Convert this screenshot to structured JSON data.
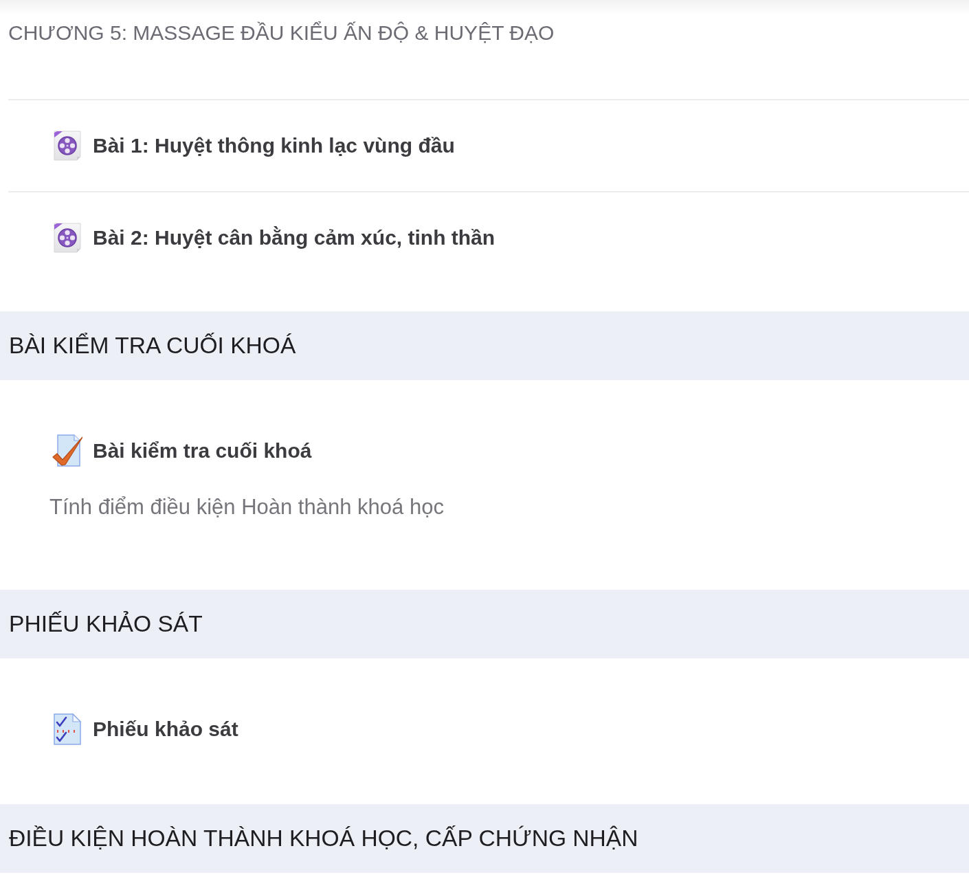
{
  "sections": [
    {
      "kind": "plain",
      "title": "CHƯƠNG 5: MASSAGE ĐẦU KIỂU ẤN ĐỘ & HUYỆT ĐẠO",
      "activities": [
        {
          "kind": "video",
          "name": "Bài 1: Huyệt thông kinh lạc vùng đầu"
        },
        {
          "kind": "video",
          "name": "Bài 2: Huyệt cân bằng cảm xúc, tinh thần"
        }
      ]
    },
    {
      "kind": "band",
      "title": "BÀI KIỂM TRA CUỐI KHOÁ",
      "activities": [
        {
          "kind": "quiz",
          "name": "Bài kiểm tra cuối khoá",
          "description": "Tính điểm điều kiện Hoàn thành khoá học"
        }
      ]
    },
    {
      "kind": "band",
      "title": "PHIẾU KHẢO SÁT",
      "activities": [
        {
          "kind": "feedback",
          "name": "Phiếu khảo sát"
        }
      ]
    },
    {
      "kind": "band",
      "title": "ĐIỀU KIỆN HOÀN THÀNH KHOÁ HỌC, CẤP CHỨNG NHẬN"
    }
  ]
}
